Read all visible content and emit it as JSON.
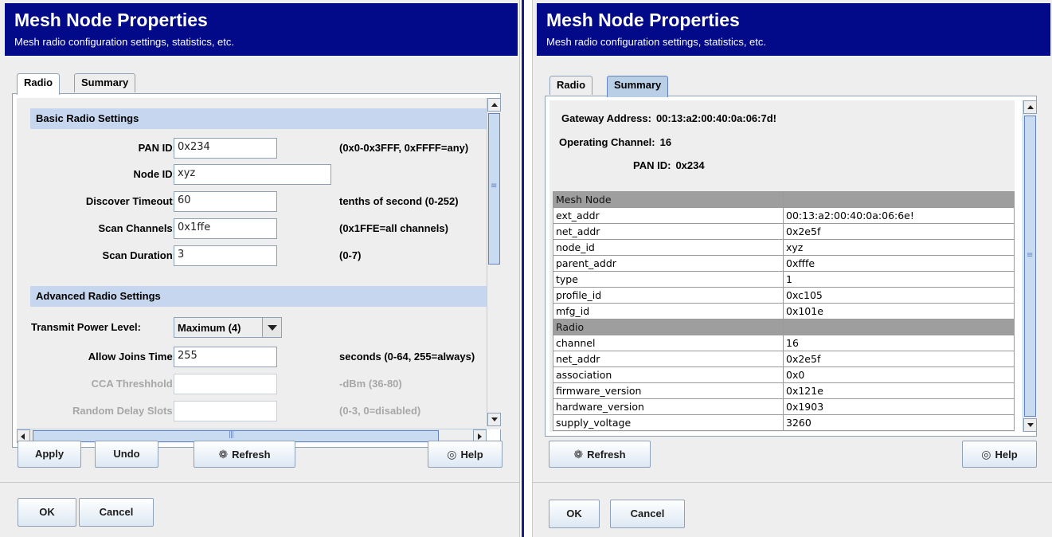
{
  "left": {
    "banner": {
      "title": "Mesh Node Properties",
      "subtitle": "Mesh radio configuration settings, statistics, etc."
    },
    "tabs": [
      {
        "label": "Radio"
      },
      {
        "label": "Summary"
      }
    ],
    "basic": {
      "header": "Basic Radio Settings",
      "rows": [
        {
          "label": "PAN ID:",
          "value": "0x234",
          "hint": "(0x0-0x3FFF, 0xFFFF=any)"
        },
        {
          "label": "Node ID:",
          "value": "xyz",
          "hint": ""
        },
        {
          "label": "Discover Timeout:",
          "value": "60",
          "hint": "tenths of second (0-252)"
        },
        {
          "label": "Scan Channels:",
          "value": "0x1ffe",
          "hint": "(0x1FFE=all channels)"
        },
        {
          "label": "Scan Duration:",
          "value": "3",
          "hint": "(0-7)"
        }
      ]
    },
    "advanced": {
      "header": "Advanced Radio Settings",
      "transmit_label": "Transmit Power Level:",
      "transmit_value": "Maximum (4)",
      "allow_label": "Allow Joins Time:",
      "allow_value": "255",
      "allow_hint": "seconds (0-64, 255=always)",
      "cca_label": "CCA Threshhold:",
      "cca_value": "",
      "cca_hint": "-dBm (36-80)",
      "delay_label": "Random Delay Slots:",
      "delay_value": "",
      "delay_hint": "(0-3, 0=disabled)"
    },
    "buttons": {
      "apply": "Apply",
      "undo": "Undo",
      "refresh": "Refresh",
      "help": "Help",
      "ok": "OK",
      "cancel": "Cancel"
    }
  },
  "right": {
    "banner": {
      "title": "Mesh Node Properties",
      "subtitle": "Mesh radio configuration settings, statistics, etc."
    },
    "tabs": [
      {
        "label": "Radio"
      },
      {
        "label": "Summary"
      }
    ],
    "summary": {
      "gateway_label": "Gateway Address:",
      "gateway_value": "00:13:a2:00:40:0a:06:7d!",
      "channel_label": "Operating Channel:",
      "channel_value": "16",
      "pan_label": "PAN ID:",
      "pan_value": "0x234"
    },
    "table": [
      {
        "group": true,
        "key": "Mesh Node",
        "value": ""
      },
      {
        "key": "ext_addr",
        "value": "00:13:a2:00:40:0a:06:6e!"
      },
      {
        "key": "net_addr",
        "value": "0x2e5f"
      },
      {
        "key": "node_id",
        "value": "xyz"
      },
      {
        "key": "parent_addr",
        "value": "0xfffe"
      },
      {
        "key": "type",
        "value": "1"
      },
      {
        "key": "profile_id",
        "value": "0xc105"
      },
      {
        "key": "mfg_id",
        "value": "0x101e"
      },
      {
        "group": true,
        "key": "Radio",
        "value": ""
      },
      {
        "key": "channel",
        "value": "16"
      },
      {
        "key": "net_addr",
        "value": "0x2e5f"
      },
      {
        "key": "association",
        "value": "0x0"
      },
      {
        "key": "firmware_version",
        "value": "0x121e"
      },
      {
        "key": "hardware_version",
        "value": "0x1903"
      },
      {
        "key": "supply_voltage",
        "value": "3260"
      }
    ],
    "buttons": {
      "refresh": "Refresh",
      "help": "Help",
      "ok": "OK",
      "cancel": "Cancel"
    }
  },
  "icons": {
    "refresh": "refresh-icon",
    "help": "help-icon"
  },
  "colors": {
    "banner_bg": "#020a8a",
    "section_bg": "#c5d6ee",
    "tab_highlight": "#b8cfe5",
    "table_group_bg": "#9e9e9e"
  }
}
